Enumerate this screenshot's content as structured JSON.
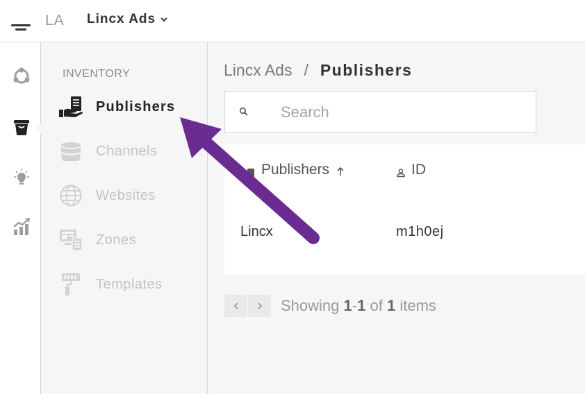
{
  "topbar": {
    "org_abbr": "LA",
    "org_name": "Lincx Ads",
    "menu_icon": "hamburger-icon",
    "dropdown_icon": "chevron-down-icon"
  },
  "rail": {
    "items": [
      {
        "icon": "network-icon"
      },
      {
        "icon": "inventory-bucket-icon",
        "active": true
      },
      {
        "icon": "lightbulb-icon"
      },
      {
        "icon": "analytics-icon"
      }
    ]
  },
  "subnav": {
    "section_label": "INVENTORY",
    "items": [
      {
        "label": "Publishers",
        "icon": "publisher-hand-icon",
        "active": true
      },
      {
        "label": "Channels",
        "icon": "channels-stack-icon"
      },
      {
        "label": "Websites",
        "icon": "globe-icon"
      },
      {
        "label": "Zones",
        "icon": "zones-icon"
      },
      {
        "label": "Templates",
        "icon": "paint-roller-icon"
      }
    ]
  },
  "breadcrumb": {
    "parent": "Lincx Ads",
    "separator": "/",
    "current": "Publishers"
  },
  "search": {
    "placeholder": "Search",
    "value": ""
  },
  "table": {
    "columns": [
      {
        "label": "Publishers",
        "sort": "ascending"
      },
      {
        "label": "ID"
      }
    ],
    "rows": [
      {
        "name": "Lincx",
        "id": "m1h0ej"
      }
    ]
  },
  "pagination": {
    "prefix": "Showing",
    "from": "1",
    "dash": "-",
    "to": "1",
    "of_word": "of",
    "total": "1",
    "suffix": "items"
  },
  "annotation": {
    "arrow_color": "#6a2c91"
  },
  "colors": {
    "rail_active": "#222222",
    "rail_inactive": "#9e9e9e",
    "nav_inactive": "#c3c3c3",
    "panel_bg": "#f6f6f6"
  }
}
